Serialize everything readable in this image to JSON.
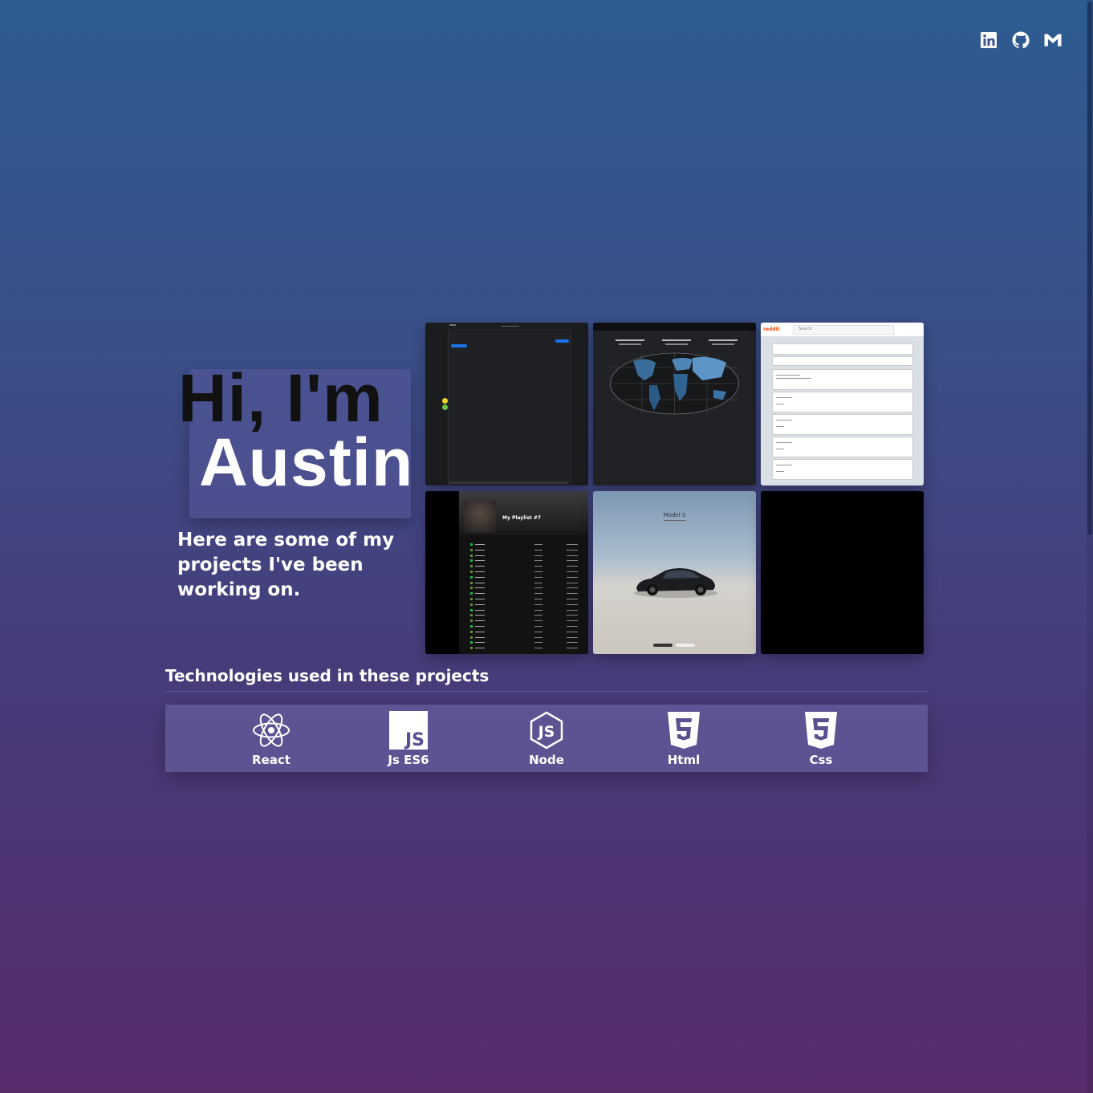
{
  "hero": {
    "greeting": "Hi, I'm",
    "name": "Austin",
    "intro": "Here are some of my projects I've been working on."
  },
  "social": [
    {
      "icon": "linkedin-icon",
      "label": "LinkedIn"
    },
    {
      "icon": "github-icon",
      "label": "GitHub"
    },
    {
      "icon": "gmail-icon",
      "label": "Gmail"
    }
  ],
  "projects": {
    "reddit_logo": "reddit",
    "reddit_search": "Search",
    "spotify_playlist": "My Playlist #7",
    "tesla_model": "Model S"
  },
  "technologies": {
    "title": "Technologies used in these projects",
    "items": [
      {
        "label": "React",
        "icon": "react-icon"
      },
      {
        "label": "Js ES6",
        "icon": "javascript-icon"
      },
      {
        "label": "Node",
        "icon": "nodejs-icon"
      },
      {
        "label": "Html",
        "icon": "html5-icon"
      },
      {
        "label": "Css",
        "icon": "css3-icon"
      }
    ]
  },
  "colors": {
    "background_top": "#2d5c91",
    "background_bottom": "#562c6b",
    "tech_bar": "#6e69aa"
  }
}
